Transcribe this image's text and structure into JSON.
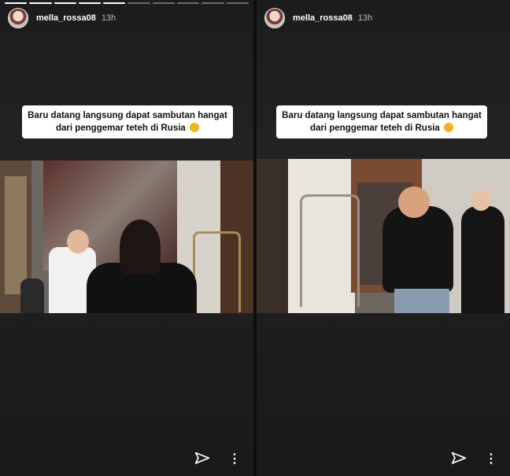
{
  "stories": [
    {
      "username": "mella_rossa08",
      "time": "13h",
      "caption": "Baru datang langsung dapat sambutan hangat dari penggemar teteh di Rusia",
      "icons": {
        "send": "send-icon",
        "more": "more-vertical-icon"
      }
    },
    {
      "username": "mella_rossa08",
      "time": "13h",
      "caption": "Baru datang langsung dapat sambutan hangat dari penggemar teteh di Rusia",
      "icons": {
        "send": "send-icon",
        "more": "more-vertical-icon"
      }
    }
  ],
  "colors": {
    "background": "#1a1a1a",
    "caption_bg": "#ffffff",
    "emoji": "#f3b31c"
  }
}
